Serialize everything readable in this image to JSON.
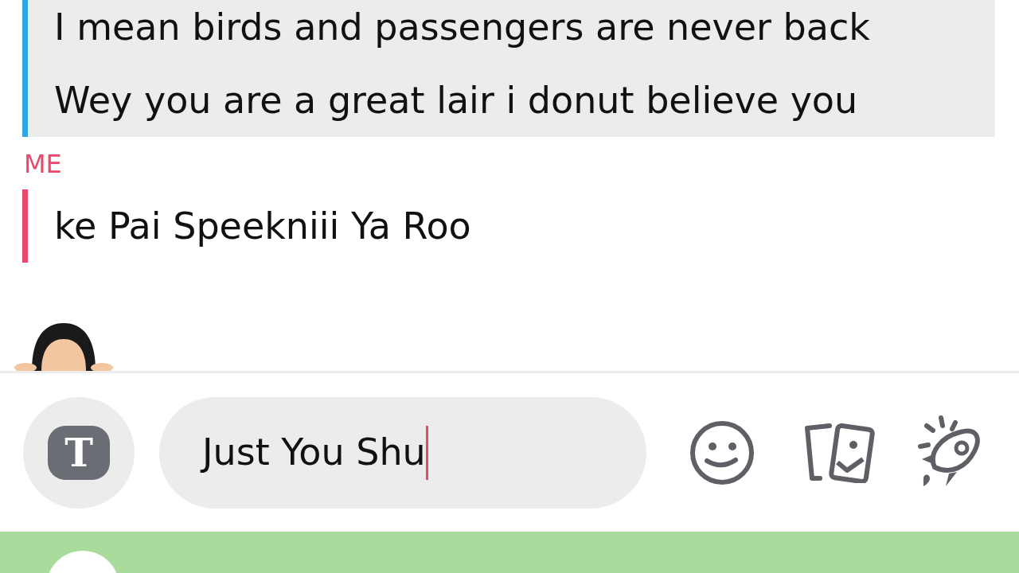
{
  "messages": [
    {
      "kind": "friend",
      "color": "#2ea6e0",
      "lines": [
        "I mean birds and passengers are never back",
        "Wey you are a great lair i donut believe you"
      ]
    },
    {
      "kind": "me",
      "sender": "ME",
      "color": "#e8496b",
      "lines": [
        "ke Pai Speekniii Ya Roo"
      ]
    }
  ],
  "composer": {
    "value": "Just You Shu",
    "text_button": "T"
  }
}
